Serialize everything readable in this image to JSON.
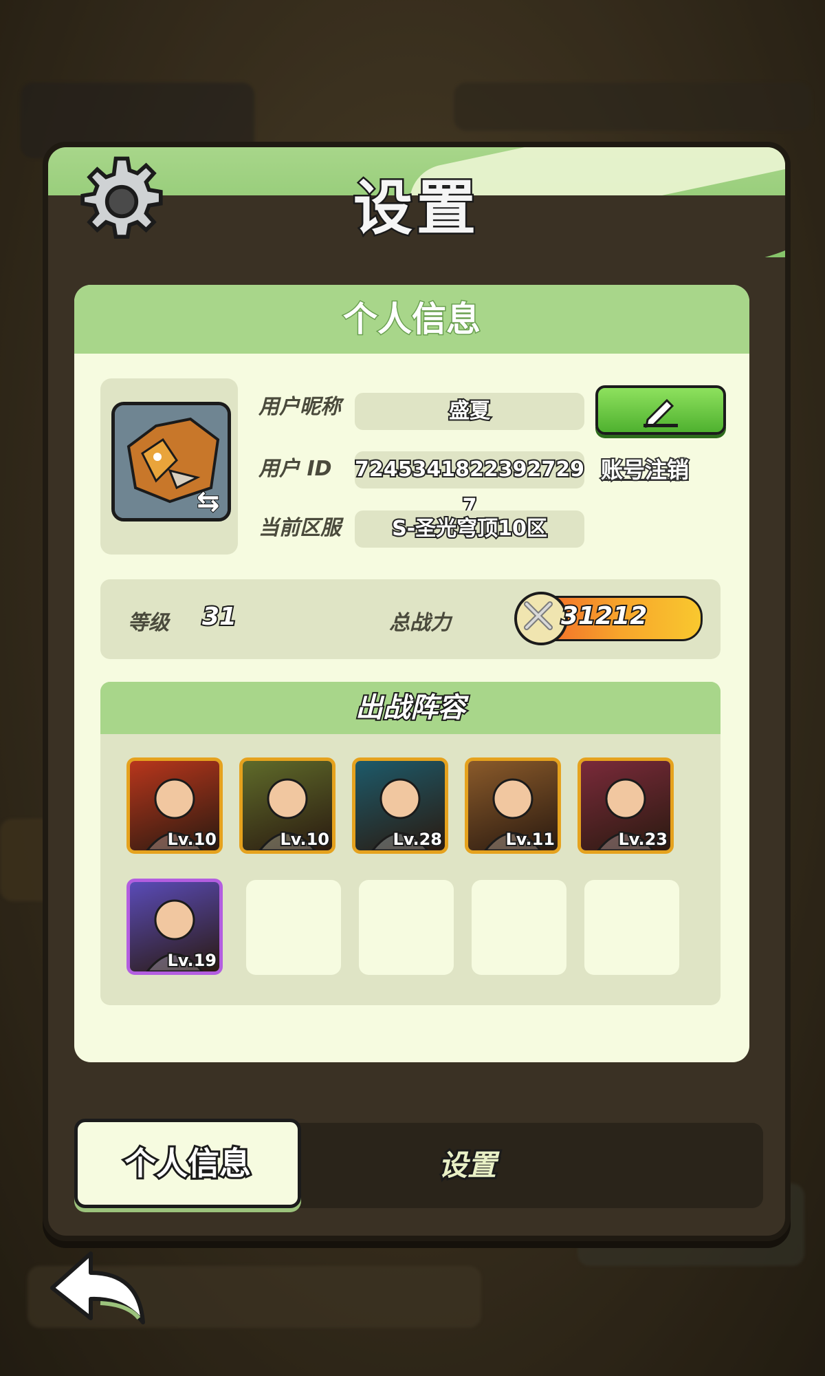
{
  "dialog": {
    "title": "设置"
  },
  "profile": {
    "section_title": "个人信息",
    "nickname_label": "用户昵称",
    "nickname": "盛夏",
    "id_label": "用户 ID",
    "user_id": "7245341822392729​7",
    "server_label": "当前区服",
    "server": "S-圣光穹顶10区",
    "cancel_account": "账号注销"
  },
  "stats": {
    "level_label": "等级",
    "level": "31",
    "power_label": "总战力",
    "power": "31212"
  },
  "lineup": {
    "title": "出战阵容",
    "heroes": [
      {
        "level": "Lv.10",
        "color": "#b8361c"
      },
      {
        "level": "Lv.10",
        "color": "#5f6b2a"
      },
      {
        "level": "Lv.28",
        "color": "#1d5a6a"
      },
      {
        "level": "Lv.11",
        "color": "#8a5a2a"
      },
      {
        "level": "Lv.23",
        "color": "#7a2a3a"
      },
      {
        "level": "Lv.19",
        "color": "#5a4bb8"
      }
    ]
  },
  "tabs": {
    "profile": "个人信息",
    "settings": "设置"
  },
  "colors": {
    "accent_green": "#a8d68a",
    "card_bg": "#f6fbe0",
    "power_orange": "#f7a52b"
  }
}
